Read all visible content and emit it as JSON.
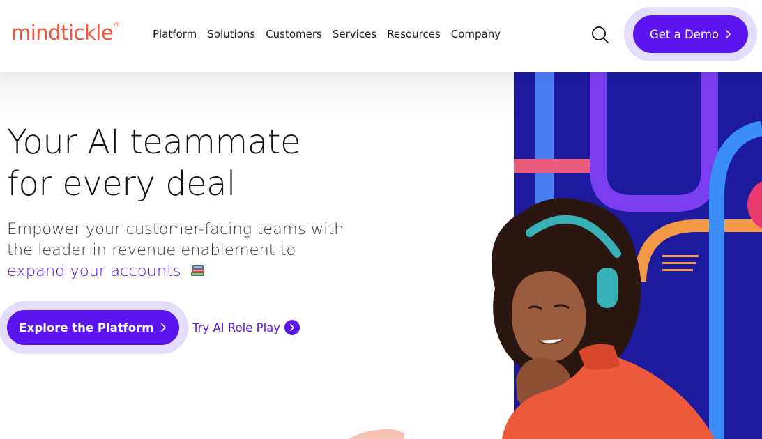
{
  "header": {
    "logo": "mindtickle",
    "logo_mark": "®",
    "nav": [
      "Platform",
      "Solutions",
      "Customers",
      "Services",
      "Resources",
      "Company"
    ],
    "demo_button": "Get a Demo"
  },
  "hero": {
    "headline": [
      "Your AI teammate",
      "for every deal"
    ],
    "subtitle_lines": [
      "Empower your customer-facing teams with",
      "the leader in revenue enablement to"
    ],
    "subtitle_accent": "expand your accounts",
    "primary_cta": "Explore the Platform",
    "secondary_cta": "Try AI Role Play"
  },
  "icons": {
    "search": "search-icon",
    "chevron": "chevron-right-icon",
    "books": "books-emoji-icon"
  },
  "colors": {
    "brand_orange": "#f0553c",
    "accent_purple": "#5b16f0",
    "halo": "#e4dcfb",
    "art_navy": "#1d1a9e"
  }
}
